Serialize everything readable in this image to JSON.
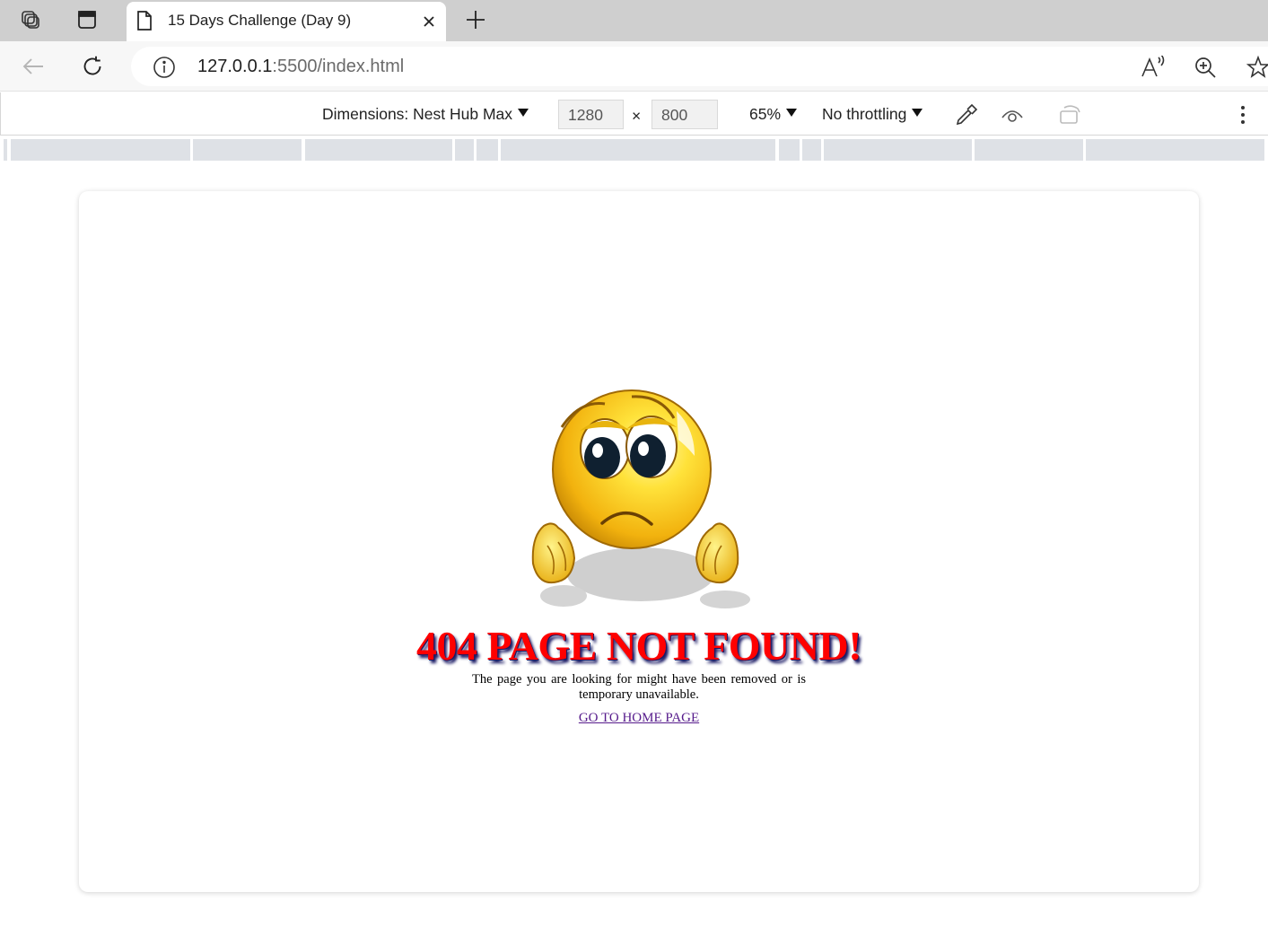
{
  "browser": {
    "tab": {
      "title": "15 Days Challenge (Day 9)"
    },
    "address": {
      "host": "127.0.0.1",
      "rest": ":5500/index.html"
    }
  },
  "devtools": {
    "dimensions_label": "Dimensions: Nest Hub Max",
    "width": "1280",
    "times": "×",
    "height": "800",
    "zoom": "65%",
    "throttling": "No throttling"
  },
  "page": {
    "heading": "404 PAGE NOT FOUND!",
    "message": "The page you are looking for might have been removed or is temporary unavailable.",
    "link": "GO TO HOME PAGE"
  },
  "colors": {
    "heading": "#ff0000",
    "heading_shadow": "#1b1b66",
    "link": "#551a8b",
    "tabstrip": "#cfcfcf"
  },
  "icons": [
    "workspaces-icon",
    "vertical-tabs-icon",
    "page-icon",
    "close-icon",
    "plus-icon",
    "back-icon",
    "refresh-icon",
    "info-icon",
    "read-aloud-icon",
    "zoom-icon",
    "star-icon",
    "eyedropper-icon",
    "vision-icon",
    "rotate-icon",
    "more-icon"
  ]
}
